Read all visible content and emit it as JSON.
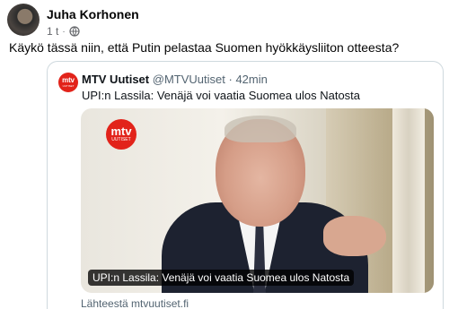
{
  "post": {
    "author": "Juha Korhonen",
    "time": "1 t",
    "separator": "·",
    "audience_icon": "globe-icon",
    "text": "Käykö tässä niin, että Putin pelastaa Suomen hyökkäysliiton otteesta?"
  },
  "embed": {
    "logo_text": "mtv",
    "logo_subtext": "UUTISET",
    "account_name": "MTV Uutiset",
    "handle": "@MTVUutiset",
    "separator": "·",
    "time": "42min",
    "text": "UPI:n Lassila: Venäjä voi vaatia Suomea ulos Natosta",
    "media_caption": "UPI:n Lassila: Venäjä voi vaatia Suomea ulos Natosta",
    "source": "Lähteestä mtvuutiset.fi"
  },
  "colors": {
    "brand_red": "#e2231a",
    "muted_text": "#536471",
    "fb_muted": "#65676b"
  }
}
